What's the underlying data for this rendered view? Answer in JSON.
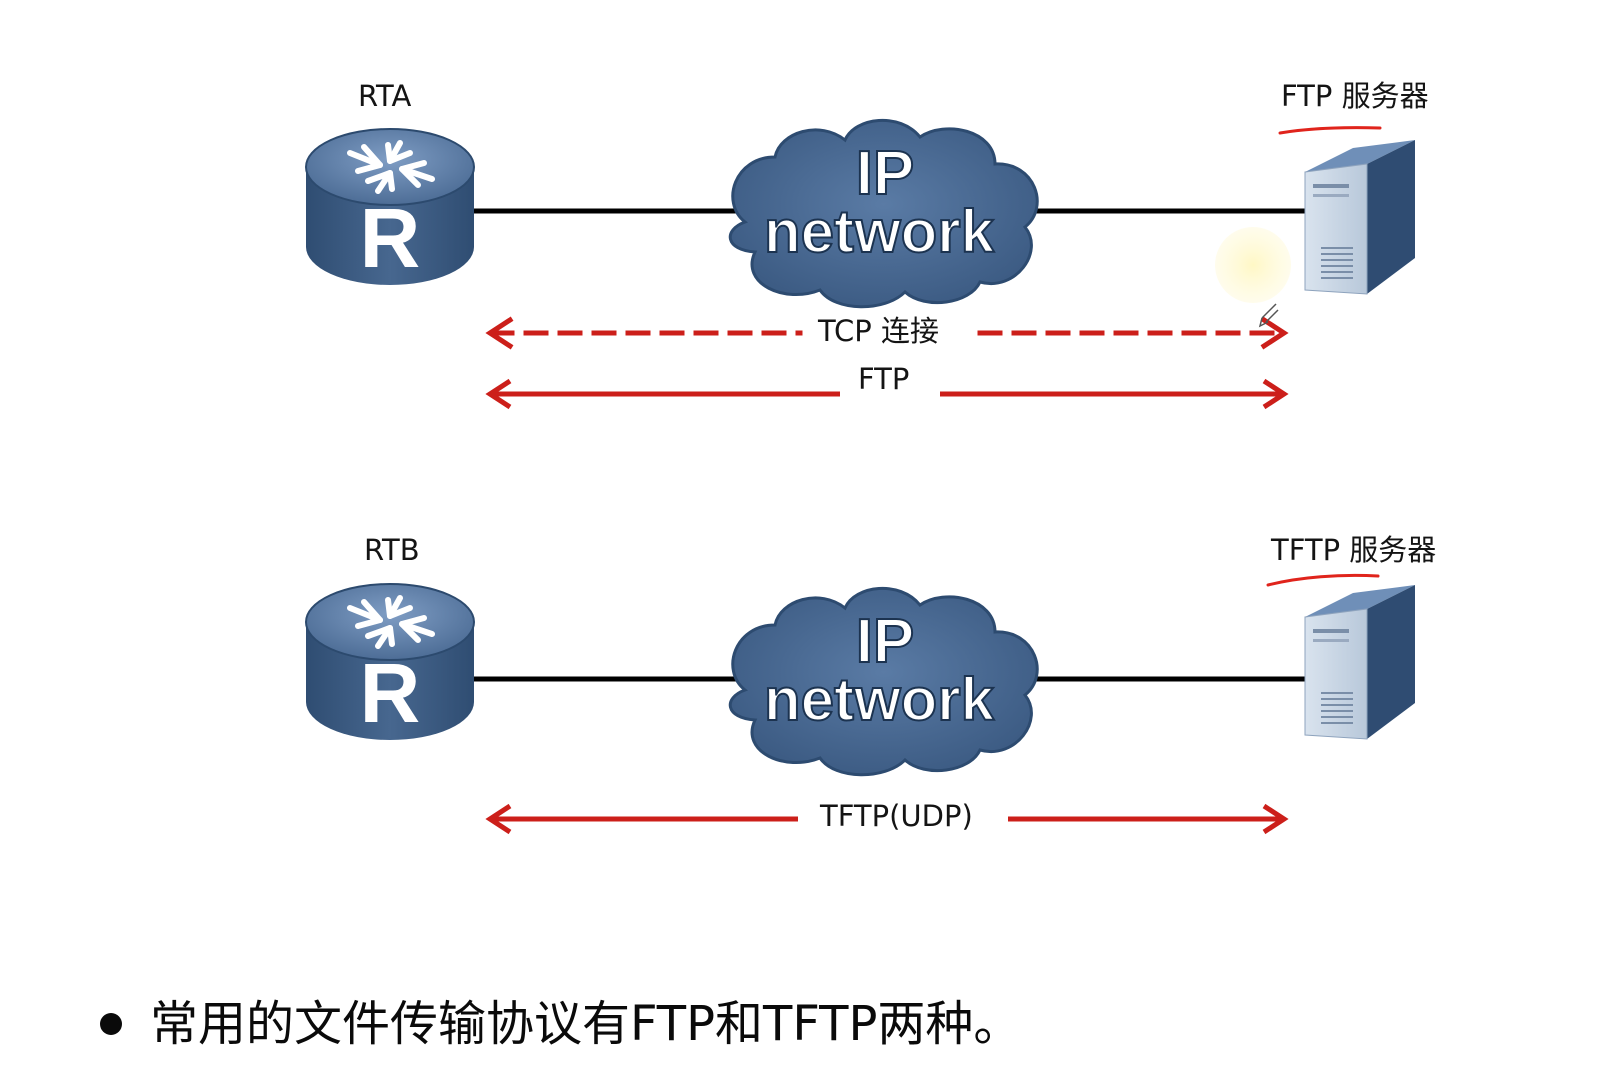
{
  "colors": {
    "device_blue": "#3f5f86",
    "device_light": "#6d8db6",
    "arrow_red": "#cc1f1a",
    "annotation_red": "#e0241c",
    "line_black": "#000000"
  },
  "top_row": {
    "router_label": "RTA",
    "router_letter": "R",
    "cloud_line1": "IP",
    "cloud_line2": "network",
    "server_label": "FTP 服务器",
    "tcp_label": "TCP 连接",
    "ftp_label": "FTP"
  },
  "bottom_row": {
    "router_label": "RTB",
    "router_letter": "R",
    "cloud_line1": "IP",
    "cloud_line2": "network",
    "server_label": "TFTP 服务器",
    "tftp_label": "TFTP(UDP)"
  },
  "bullet": {
    "text": "常用的文件传输协议有FTP和TFTP两种。"
  },
  "icons": {
    "router": "router-icon",
    "cloud": "ip-network-cloud-icon",
    "server": "server-icon",
    "pen_cursor": "pen-cursor-icon"
  }
}
